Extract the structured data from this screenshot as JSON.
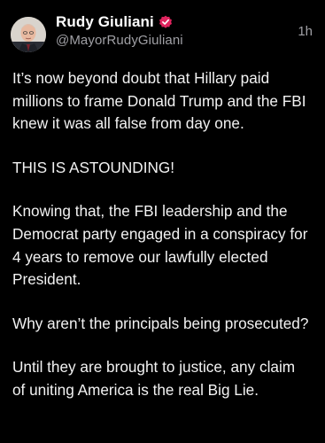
{
  "post": {
    "author": {
      "display_name": "Rudy Giuliani",
      "handle": "@MayorRudyGiuliani",
      "verified_icon": "verified-badge-icon",
      "verified_color": "#e0245e",
      "avatar_icon": "user-avatar-photo"
    },
    "timestamp": "1h",
    "paragraphs": [
      "It’s now beyond doubt that Hillary paid millions to frame Donald Trump and the FBI knew it was all false from day one.",
      "THIS IS ASTOUNDING!",
      "Knowing that, the FBI leadership and the Democrat party engaged in a conspiracy for 4 years to remove our lawfully elected President.",
      "Why aren’t the principals being prosecuted?",
      "Until they are brought to justice, any claim of uniting America is the real Big Lie."
    ]
  }
}
